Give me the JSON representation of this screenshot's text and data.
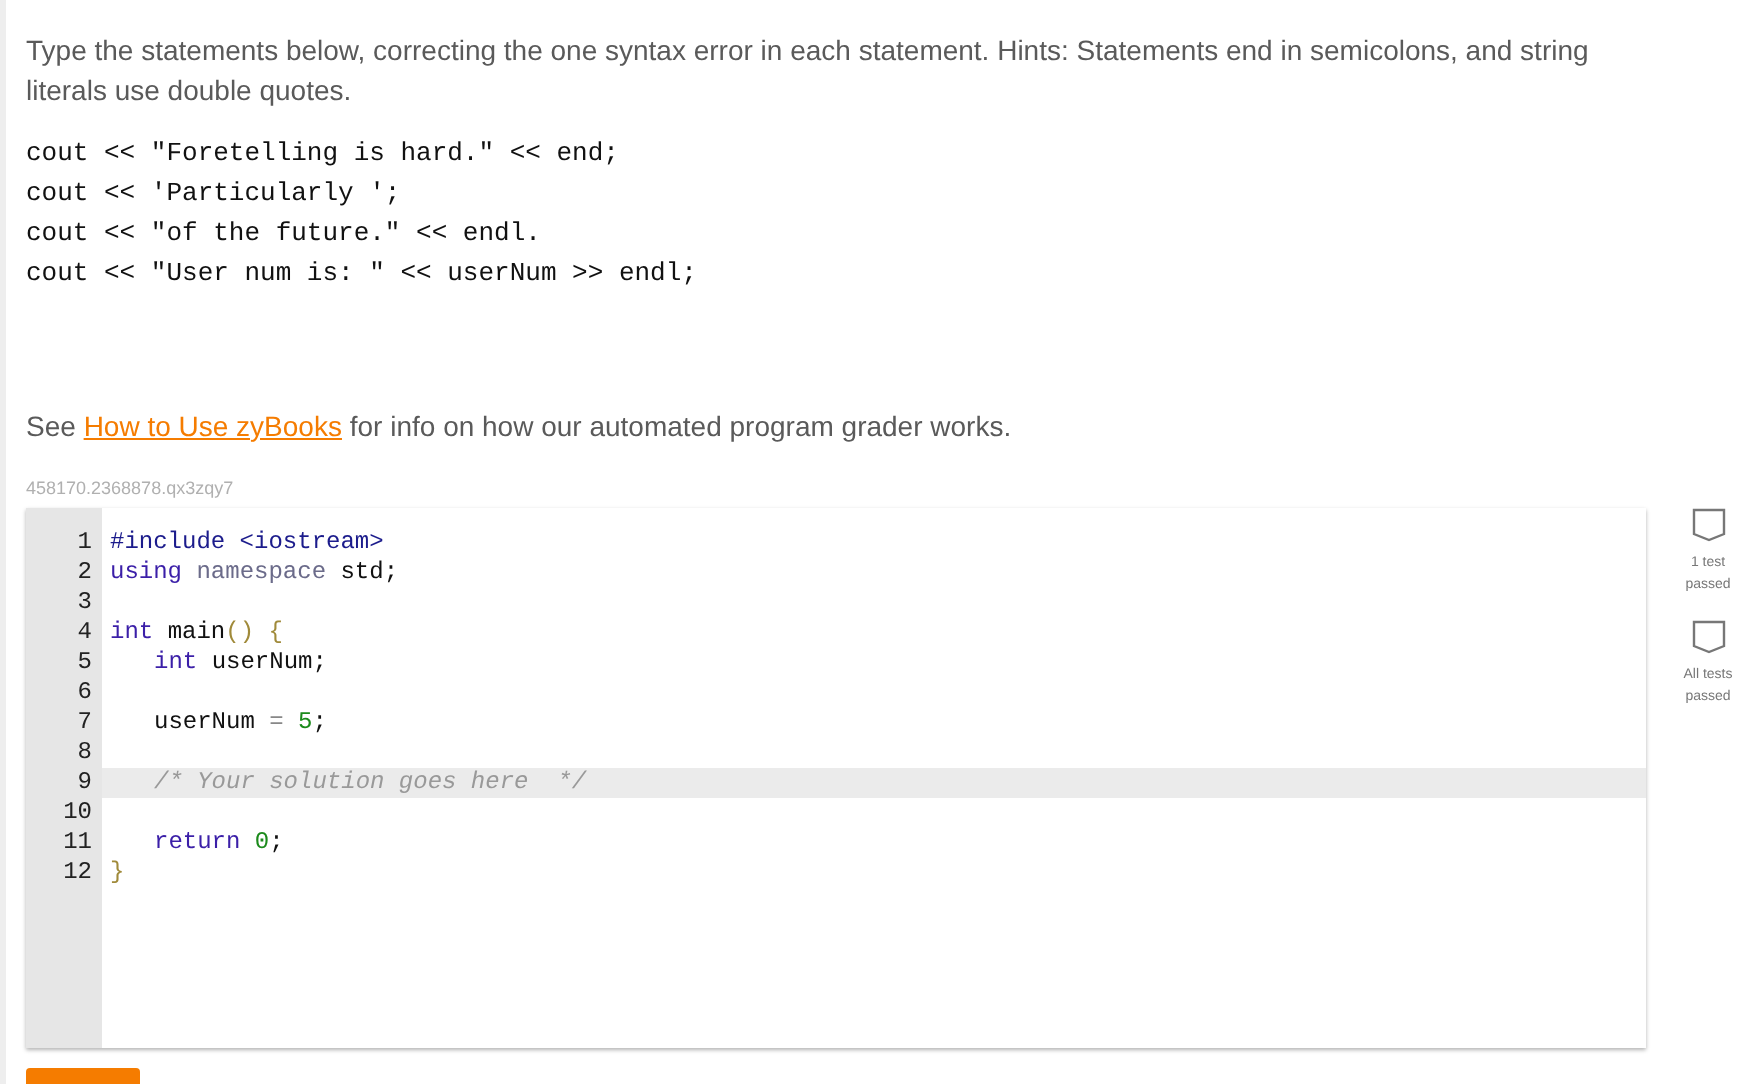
{
  "instructions": "Type the statements below, correcting the one syntax error in each statement. Hints: Statements end in semicolons, and string literals use double quotes.",
  "statements": [
    "cout << \"Foretelling is hard.\" << end;",
    "cout << 'Particularly ';",
    "cout << \"of the future.\" << endl.",
    "cout << \"User num is: \" << userNum >> endl;"
  ],
  "help": {
    "before": "See",
    "link": "How to Use zyBooks",
    "after": "for info on how our automated program grader works."
  },
  "exercise_id": "458170.2368878.qx3zqy7",
  "editor": {
    "lines": [
      {
        "number": "1",
        "active": false,
        "tokens": [
          {
            "kind": "meta",
            "text": "#include <iostream>"
          }
        ]
      },
      {
        "number": "2",
        "active": false,
        "tokens": [
          {
            "kind": "keyword",
            "text": "using "
          },
          {
            "kind": "def",
            "text": "namespace "
          },
          {
            "kind": "plain",
            "text": "std;"
          }
        ]
      },
      {
        "number": "3",
        "active": false
      },
      {
        "number": "4",
        "active": false,
        "tokens": [
          {
            "kind": "keyword",
            "text": "int "
          },
          {
            "kind": "plain",
            "text": "main"
          },
          {
            "kind": "bracket",
            "text": "() {"
          }
        ]
      },
      {
        "number": "5",
        "active": false,
        "indent": true,
        "tokens": [
          {
            "kind": "keyword",
            "text": "int "
          },
          {
            "kind": "plain",
            "text": "userNum;"
          }
        ]
      },
      {
        "number": "6",
        "active": false
      },
      {
        "number": "7",
        "active": false,
        "indent": true,
        "tokens": [
          {
            "kind": "plain",
            "text": "userNum "
          },
          {
            "kind": "op",
            "text": "= "
          },
          {
            "kind": "number",
            "text": "5"
          },
          {
            "kind": "plain",
            "text": ";"
          }
        ]
      },
      {
        "number": "8",
        "active": false
      },
      {
        "number": "9",
        "active": true,
        "indent": true,
        "tokens": [
          {
            "kind": "comment",
            "text": "/* Your solution goes here  */"
          }
        ]
      },
      {
        "number": "10",
        "active": false
      },
      {
        "number": "11",
        "active": false,
        "indent": true,
        "tokens": [
          {
            "kind": "keyword",
            "text": "return "
          },
          {
            "kind": "number",
            "text": "0"
          },
          {
            "kind": "plain",
            "text": ";"
          }
        ]
      },
      {
        "number": "12",
        "active": false,
        "tokens": [
          {
            "kind": "bracket",
            "text": "}"
          }
        ]
      }
    ]
  },
  "tests": [
    {
      "label": "1 test passed",
      "passed": false
    },
    {
      "label": "All tests passed",
      "passed": false
    }
  ]
}
